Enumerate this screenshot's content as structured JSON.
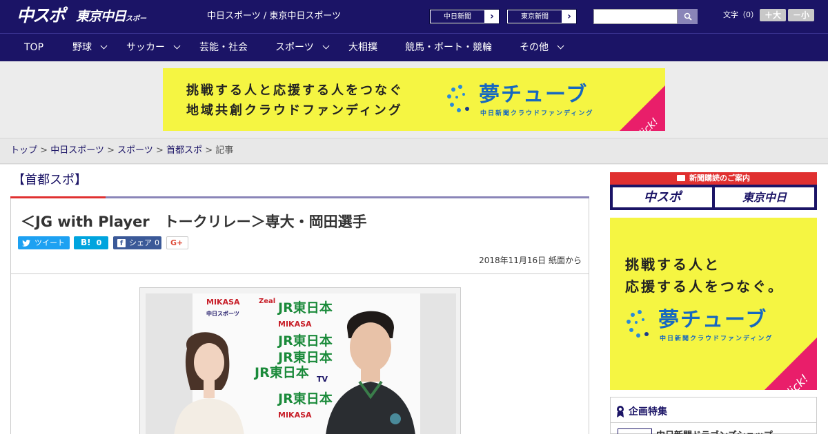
{
  "header": {
    "logo_chuspo": "中スポ",
    "logo_tokyo": "東京中日",
    "logo_tokyo_sub": "スポーツ",
    "site_links": "中日スポーツ / 東京中日スポーツ",
    "paper_buttons": [
      "中日新聞",
      "東京新聞"
    ],
    "font_size_label": "文字（0）",
    "font_plus": "＋大",
    "font_minus": "－小"
  },
  "nav": [
    {
      "label": "TOP",
      "has_menu": false
    },
    {
      "label": "野球",
      "has_menu": true
    },
    {
      "label": "サッカー",
      "has_menu": true
    },
    {
      "label": "芸能・社会",
      "has_menu": false
    },
    {
      "label": "スポーツ",
      "has_menu": true
    },
    {
      "label": "大相撲",
      "has_menu": false
    },
    {
      "label": "競馬・ボート・競輪",
      "has_menu": false
    },
    {
      "label": "その他",
      "has_menu": true
    }
  ],
  "banner": {
    "line1": "挑戦する人と応援する人をつなぐ",
    "line2": "地域共創クラウドファンディング",
    "brand": "夢チューブ",
    "brand_sub": "中日新聞クラウドファンディング",
    "click": "Click!"
  },
  "breadcrumb": {
    "items": [
      "トップ",
      "中日スポーツ",
      "スポーツ",
      "首都スポ"
    ],
    "current": "記事",
    "separator": ">"
  },
  "article": {
    "section": "【首都スポ】",
    "headline": "＜JG with Player　トークリレー＞専大・岡田選手",
    "date": "2018年11月16日 紙面から",
    "share": {
      "tweet": "ツイート",
      "hatena": "B!",
      "hatena_count": "0",
      "facebook": "シェア",
      "facebook_count": "0",
      "gplus": "G+"
    },
    "photo_backdrop": [
      "MIKASA",
      "Zeal",
      "JR東日本",
      "中日スポーツ",
      "TV"
    ]
  },
  "sidebar": {
    "subscribe_head": "新聞購読のご案内",
    "subscribe_logos": [
      "中スポ",
      "東京中日"
    ],
    "ad_line1": "挑戦する人と",
    "ad_line2": "応援する人をつなぐ。",
    "ad_brand": "夢チューブ",
    "ad_brand_sub": "中日新聞クラウドファンディング",
    "ad_click": "Click!",
    "feature_title": "企画特集",
    "feature_item": "中日新聞ドラゴンズショップ"
  },
  "colors": {
    "navy": "#1b1466",
    "accent_red": "#e03030",
    "banner_yellow": "#f5f542",
    "click_pink": "#e91e6a",
    "brand_blue": "#1668c0"
  }
}
